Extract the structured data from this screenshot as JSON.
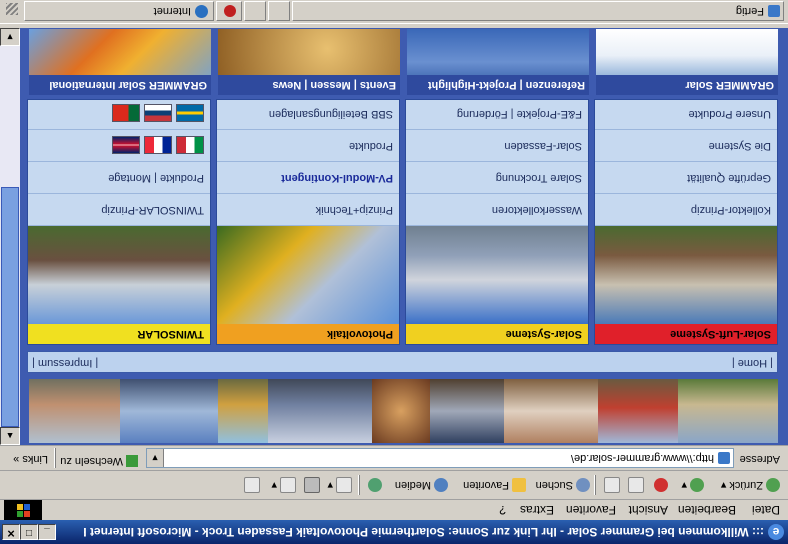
{
  "window": {
    "title": "::: Willkommen bei Grammer Solar - Ihr Link zur Sonne: Solarthermie Photovoltaik Fassaden Trock - Microsoft Internet Expl...",
    "min": "_",
    "max": "□",
    "close": "✕"
  },
  "menu": {
    "items": [
      "Datei",
      "Bearbeiten",
      "Ansicht",
      "Favoriten",
      "Extras",
      "?"
    ]
  },
  "toolbar": {
    "back": "Zurück",
    "search": "Suchen",
    "favorites": "Favoriten",
    "media": "Medien"
  },
  "address": {
    "label": "Adresse",
    "url": "http:\\\\www.grammer-solar.de\\",
    "go": "Wechseln zu",
    "links": "Links"
  },
  "site": {
    "nav_left": "| Home |",
    "nav_right": "| Impressum |",
    "columns": [
      {
        "header": "Solar-Luft-Systeme",
        "header_color": "#e0202a",
        "header_text": "#000000",
        "items": [
          "Kollektor-Prinzip",
          "Geprüfte Qualität",
          "Die Systeme",
          "Unsere Produkte"
        ]
      },
      {
        "header": "Solar-Systeme",
        "header_color": "#f0d020",
        "header_text": "#000000",
        "items": [
          "Wasserkollektoren",
          "Solare Trocknung",
          "Solar-Fassaden",
          "F&E-Projekte | Förderung"
        ]
      },
      {
        "header": "Photovoltaik",
        "header_color": "#f0a020",
        "header_text": "#000000",
        "items": [
          "Prinzip+Technik",
          "PV-Modul-Kontingent",
          "Produkte",
          "SBB Beteiligungsanlagen"
        ]
      },
      {
        "header": "TWINSOLAR",
        "header_color": "#f0e020",
        "header_text": "#000000",
        "items": [
          "TWINSOLAR-Prinzip",
          "Produkte | Montage"
        ]
      }
    ],
    "bottom": [
      "GRAMMER Solar",
      "Referenzen | Projekt-Highlight",
      "Events | Messen | News",
      "GRAMMER Solar International"
    ]
  },
  "status": {
    "text": "Fertig",
    "zone": "Internet"
  }
}
